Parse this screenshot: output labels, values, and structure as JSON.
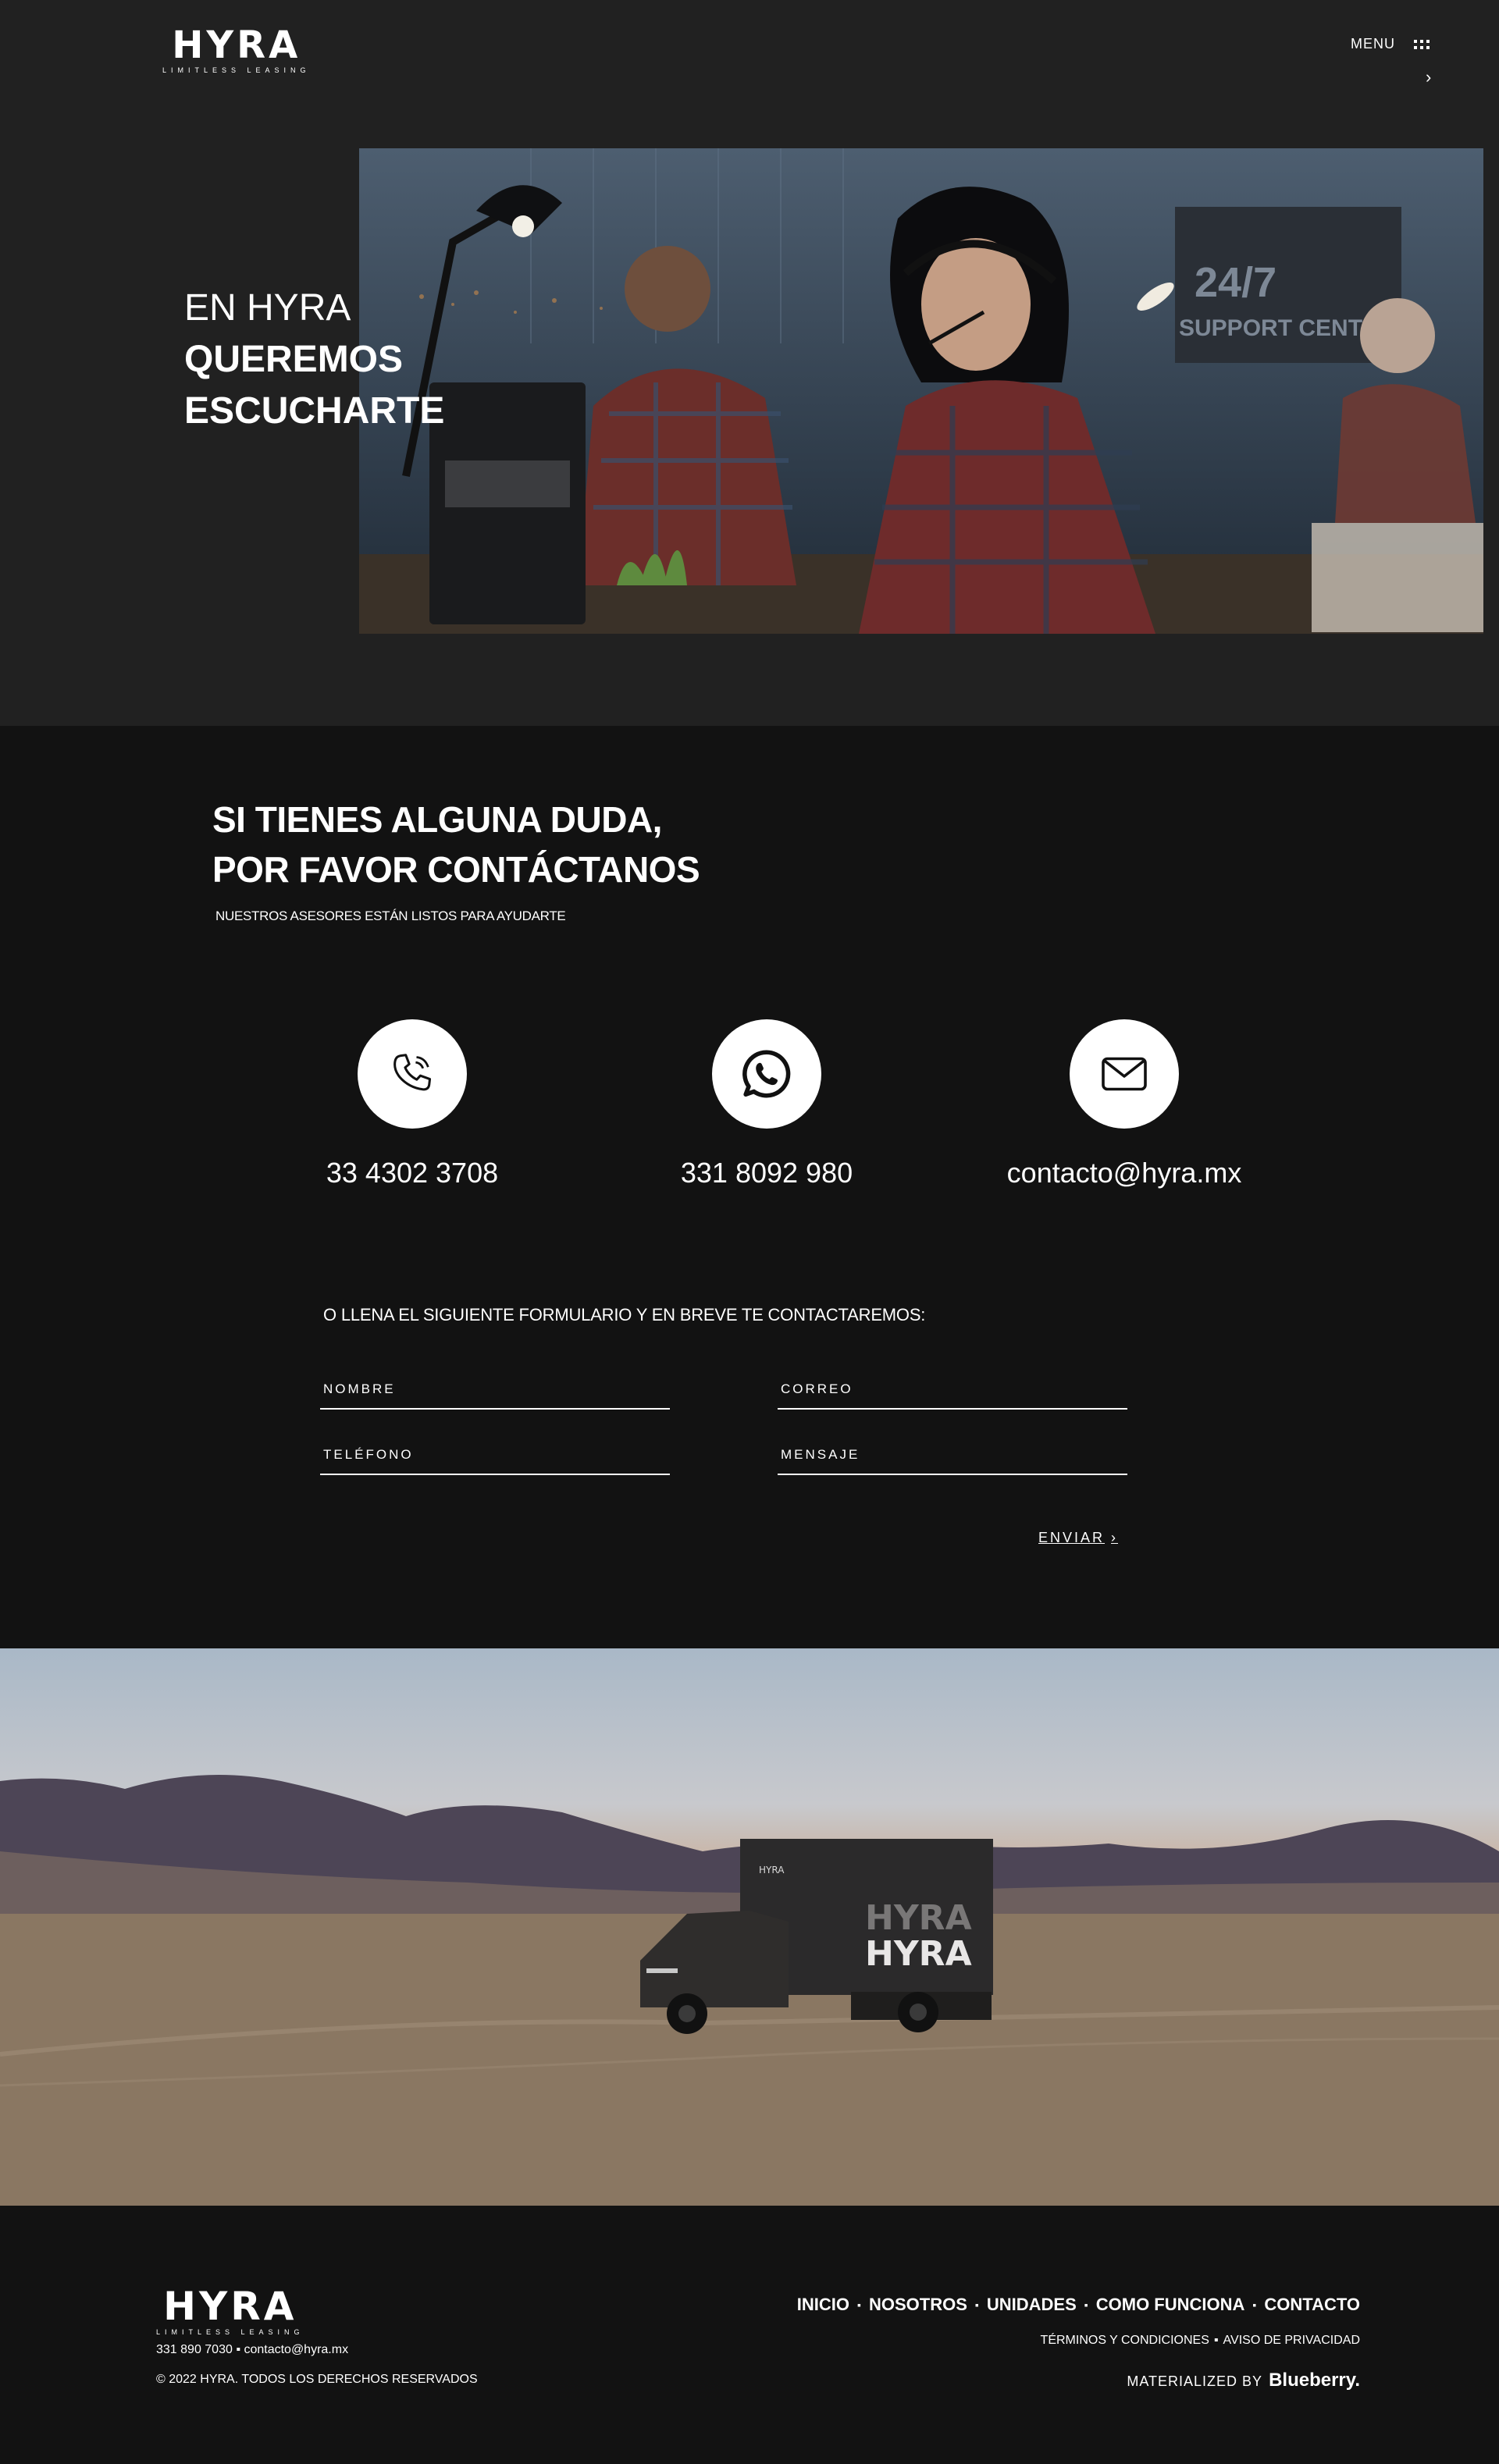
{
  "header": {
    "logo_word": "HYRA",
    "logo_tagline": "LIMITLESS LEASING",
    "menu_label": "MENU"
  },
  "hero": {
    "title_light": "EN HYRA",
    "title_bold_1": "QUEREMOS",
    "title_bold_2": "ESCUCHARTE",
    "image_text": "24/7 SUPPORT CENTER"
  },
  "contact": {
    "heading_1": "SI TIENES ALGUNA DUDA,",
    "heading_2": "POR FAVOR CONTÁCTANOS",
    "subheading": "NUESTROS ASESORES ESTÁN LISTOS PARA AYUDARTE",
    "items": [
      {
        "icon": "phone-icon",
        "text": "33 4302 3708"
      },
      {
        "icon": "whatsapp-icon",
        "text": "331 8092 980"
      },
      {
        "icon": "email-icon",
        "text": "contacto@hyra.mx"
      }
    ]
  },
  "form": {
    "intro": "O LLENA EL SIGUIENTE FORMULARIO Y EN BREVE TE CONTACTAREMOS:",
    "name_placeholder": "NOMBRE",
    "email_placeholder": "CORREO",
    "phone_placeholder": "TELÉFONO",
    "message_placeholder": "MENSAJE",
    "submit_label": "ENVIAR"
  },
  "landscape": {
    "truck_brand": "HYRA"
  },
  "footer": {
    "logo_word": "HYRA",
    "logo_tagline": "LIMITLESS LEASING",
    "phone": "331 890 7030",
    "email": "contacto@hyra.mx",
    "copyright": "© 2022 HYRA. TODOS LOS DERECHOS RESERVADOS",
    "nav": [
      "INICIO",
      "NOSOTROS",
      "UNIDADES",
      "COMO FUNCIONA",
      "CONTACTO"
    ],
    "terms": "TÉRMINOS Y CONDICIONES",
    "privacy": "AVISO DE PRIVACIDAD",
    "made_by_label": "MATERIALIZED BY",
    "made_by_brand": "Blueberry."
  }
}
